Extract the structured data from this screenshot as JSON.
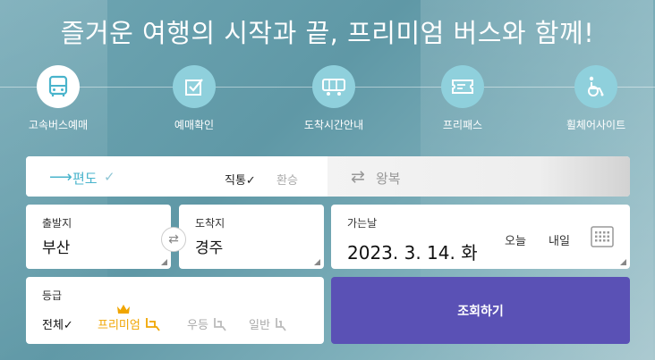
{
  "headline": "즐거운 여행의 시작과 끝, 프리미엄 버스와 함께!",
  "menu": [
    {
      "label": "고속버스예매",
      "icon": "bus-icon",
      "active": true
    },
    {
      "label": "예매확인",
      "icon": "checkbox-icon",
      "active": false
    },
    {
      "label": "도착시간안내",
      "icon": "route-icon",
      "active": false
    },
    {
      "label": "프리패스",
      "icon": "ticket-icon",
      "active": false
    },
    {
      "label": "휠체어사이트",
      "icon": "wheelchair-icon",
      "active": false
    }
  ],
  "trip": {
    "oneway_label": "편도",
    "oneway_check": "✓",
    "direct_label": "직통✓",
    "transfer_label": "환승",
    "roundtrip_label": "왕복"
  },
  "departure": {
    "label": "출발지",
    "value": "부산"
  },
  "arrival": {
    "label": "도착지",
    "value": "경주"
  },
  "date": {
    "label": "가는날",
    "value": "2023. 3. 14. 화",
    "today": "오늘",
    "tomorrow": "내일"
  },
  "grade": {
    "label": "등급",
    "all": "전체✓",
    "premium": "프리미엄",
    "first": "우등",
    "general": "일반"
  },
  "search_label": "조회하기",
  "colors": {
    "accent": "#49b4cc",
    "search_button": "#5a51b5",
    "premium": "#f0a500",
    "menu_circle": "#8fd0dc"
  }
}
